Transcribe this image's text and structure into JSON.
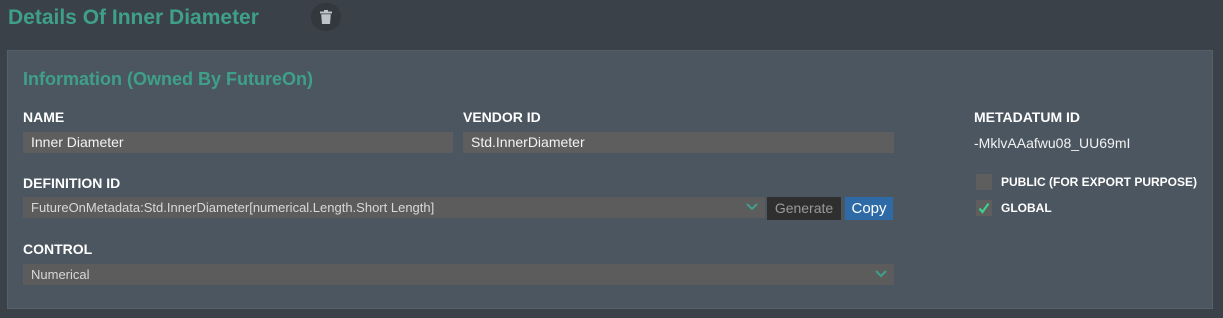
{
  "header": {
    "title": "Details Of Inner Diameter",
    "delete_icon": "trash-icon"
  },
  "panel": {
    "section_title": "Information (Owned By FutureOn)",
    "name": {
      "label": "NAME",
      "value": "Inner Diameter"
    },
    "vendor_id": {
      "label": "VENDOR ID",
      "value": "Std.InnerDiameter"
    },
    "metadatum_id": {
      "label": "METADATUM ID",
      "value": "-MklvAAafwu08_UU69mI"
    },
    "definition_id": {
      "label": "DEFINITION ID",
      "value": "FutureOnMetadata:Std.InnerDiameter[numerical.Length.Short Length]",
      "generate_label": "Generate",
      "copy_label": "Copy"
    },
    "control": {
      "label": "CONTROL",
      "value": "Numerical"
    },
    "options": {
      "public": {
        "label": "PUBLIC (FOR EXPORT PURPOSE)",
        "checked": false
      },
      "global": {
        "label": "GLOBAL",
        "checked": true
      }
    }
  },
  "colors": {
    "accent": "#3fa08a",
    "copy_button": "#2d6aa6",
    "check": "#3fcf8e"
  }
}
